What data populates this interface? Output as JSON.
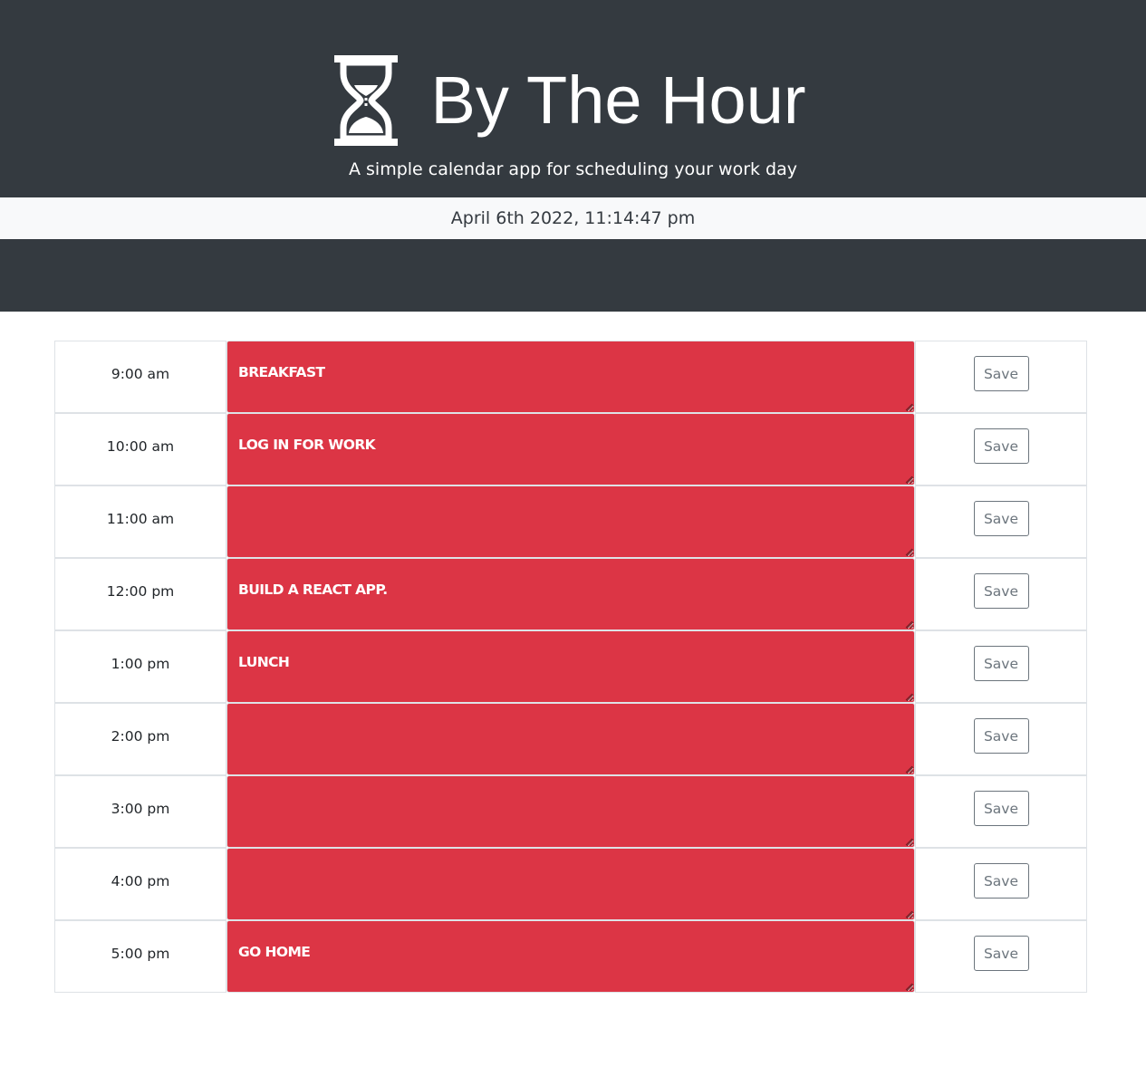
{
  "header": {
    "title": "By The Hour",
    "subtitle": "A simple calendar app for scheduling your work day",
    "logo_icon": "hourglass-icon",
    "background_color": "#343a40"
  },
  "date_bar": {
    "current_datetime": "April 6th 2022, 11:14:47 pm",
    "background_color": "#f8f9fa"
  },
  "colors": {
    "past_block": "#dc3545",
    "save_button_border": "#6c757d"
  },
  "schedule": {
    "rows": [
      {
        "hour": "9:00 am",
        "task": "BREAKFAST",
        "save_label": "Save"
      },
      {
        "hour": "10:00 am",
        "task": "LOG IN FOR WORK",
        "save_label": "Save"
      },
      {
        "hour": "11:00 am",
        "task": "",
        "save_label": "Save"
      },
      {
        "hour": "12:00 pm",
        "task": "BUILD A REACT APP.",
        "save_label": "Save"
      },
      {
        "hour": "1:00 pm",
        "task": "LUNCH",
        "save_label": "Save"
      },
      {
        "hour": "2:00 pm",
        "task": "",
        "save_label": "Save"
      },
      {
        "hour": "3:00 pm",
        "task": "",
        "save_label": "Save"
      },
      {
        "hour": "4:00 pm",
        "task": "",
        "save_label": "Save"
      },
      {
        "hour": "5:00 pm",
        "task": "GO HOME",
        "save_label": "Save"
      }
    ]
  }
}
